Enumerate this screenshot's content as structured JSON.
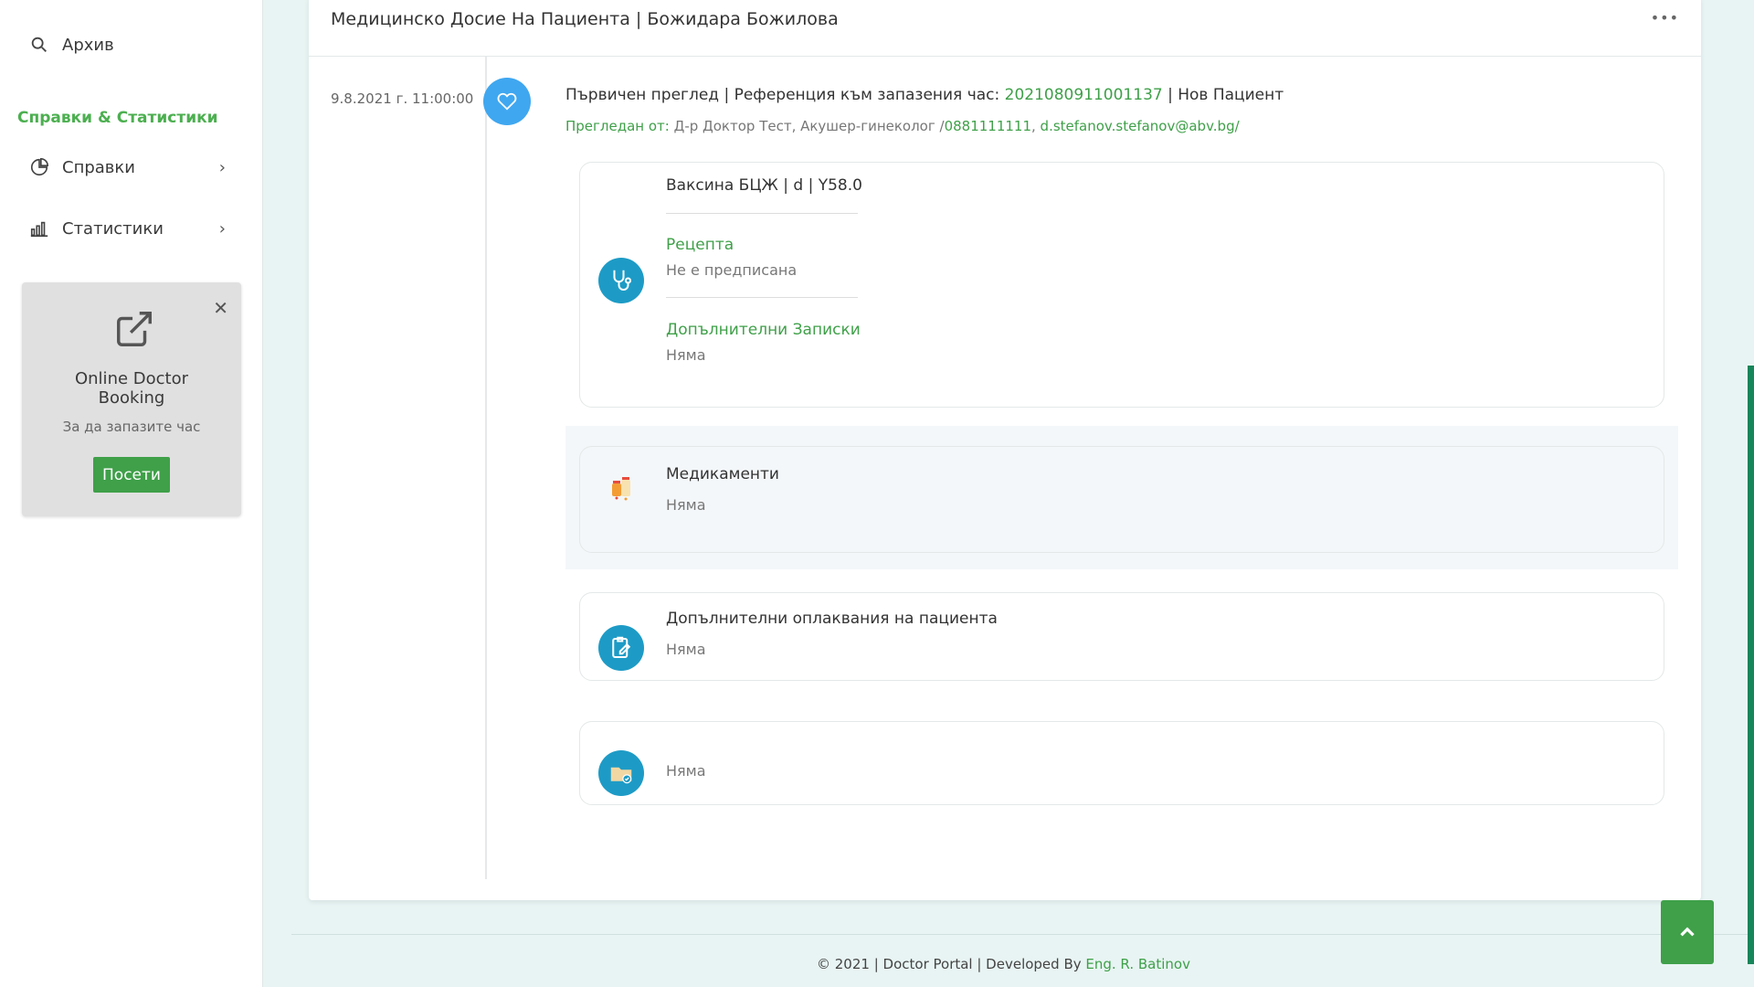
{
  "sidebar": {
    "archive_label": "Архив",
    "section_title": "Справки & Статистики",
    "items": [
      {
        "label": "Справки"
      },
      {
        "label": "Статистики"
      }
    ],
    "promo": {
      "title": "Online Doctor Booking",
      "subtitle": "За да запазите час",
      "button": "Посети"
    }
  },
  "header": {
    "title": "Медицинско Досие На Пациента | Божидара Божилова",
    "menu": "•••"
  },
  "visit": {
    "date": "9.8.2021 г. 11:00:00",
    "head_prefix": "Първичен преглед | Референция към запазения час: ",
    "reference": "2021080911001137",
    "head_suffix": " | Нов Пациент",
    "reviewed_label": "Прегледан от:",
    "doctor": " Д-р Доктор Тест, Акушер-гинеколог /",
    "phone": "0881111111",
    "sep": ", ",
    "email": "d.stefanov.stefanov@abv.bg",
    "slash": "/"
  },
  "diagnosis": {
    "title": "Ваксина БЦЖ | d | Y58.0",
    "prescription_label": "Рецепта",
    "prescription_value": "Не е предписана",
    "notes_label": "Допълнителни Записки",
    "notes_value": "Няма"
  },
  "medications": {
    "title": "Медикаменти",
    "value": "Няма"
  },
  "complaints": {
    "title": "Допълнителни оплаквания на пациента",
    "value": "Няма"
  },
  "files": {
    "value": "Няма"
  },
  "footer": {
    "text": "© 2021 | Doctor Portal | Developed By ",
    "author": "Eng. R. Batinov"
  },
  "colors": {
    "accent": "#3fa049",
    "timeline_dot": "#3fa7f0",
    "icon_bg": "#1d9bc6"
  }
}
